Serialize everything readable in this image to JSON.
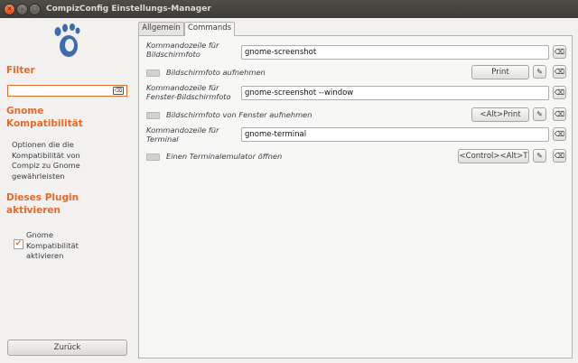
{
  "window": {
    "title": "CompizConfig Einstellungs-Manager"
  },
  "sidebar": {
    "logo_icon": "gnome-foot-icon",
    "filter_heading": "Filter",
    "filter_value": "",
    "plugin_heading": "Gnome Kompatibilität",
    "plugin_desc": [
      "Optionen die die",
      "Kompatibilität von",
      "Compiz zu Gnome",
      "gewährleisten"
    ],
    "enable_heading": [
      "Dieses Plugin",
      "aktivieren"
    ],
    "enable_checkbox": {
      "checked": true,
      "label": [
        "Gnome",
        "Kompatibilität",
        "aktivieren"
      ]
    },
    "back_button": "Zurück"
  },
  "tabs": [
    {
      "label": "Allgemein",
      "active": false
    },
    {
      "label": "Commands",
      "active": true
    }
  ],
  "commands": [
    {
      "command_label": [
        "Kommandozeile für",
        "Bildschirmfoto"
      ],
      "command_value": "gnome-screenshot",
      "binding_label": "Bildschirmfoto aufnehmen",
      "binding_key": "Print"
    },
    {
      "command_label": [
        "Kommandozeile für",
        "Fenster-Bildschirmfoto"
      ],
      "command_value": "gnome-screenshot --window",
      "binding_label": "Bildschirmfoto von Fenster aufnehmen",
      "binding_key": "<Alt>Print"
    },
    {
      "command_label": [
        "Kommandozeile für",
        "Terminal"
      ],
      "command_value": "gnome-terminal",
      "binding_label": "Einen Terminalemulator öffnen",
      "binding_key": "<Control><Alt>T"
    }
  ],
  "icons": {
    "edit": "pencil-icon",
    "reset": "clear-icon",
    "close": "close-icon"
  },
  "colors": {
    "accent": "#e46b29",
    "titlebar": "#3c3b37"
  }
}
